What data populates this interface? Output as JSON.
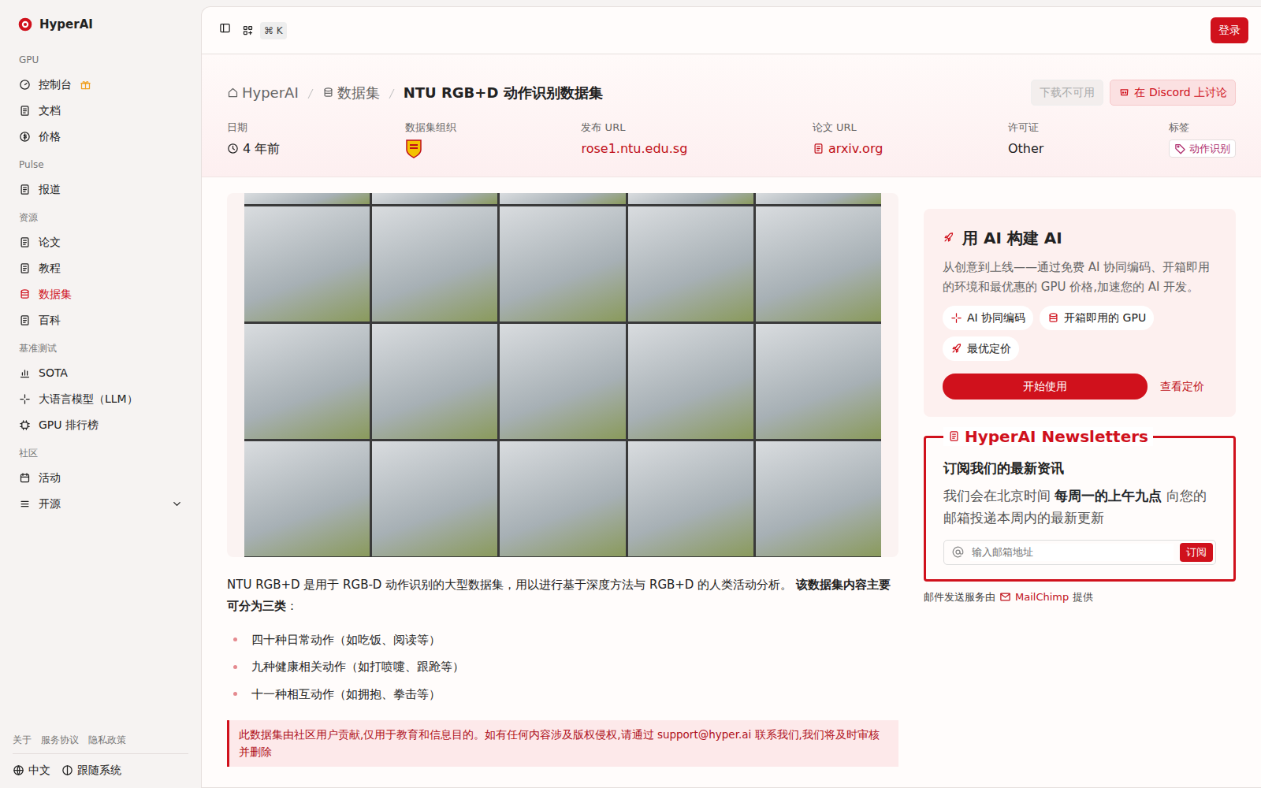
{
  "brand": {
    "name": "HyperAI"
  },
  "sidebar": {
    "groups": [
      {
        "title": "GPU",
        "items": [
          {
            "label": "控制台",
            "selected": false
          },
          {
            "label": "文档",
            "selected": false
          },
          {
            "label": "价格",
            "selected": false
          }
        ]
      },
      {
        "title": "Pulse",
        "items": [
          {
            "label": "报道",
            "selected": false
          }
        ]
      },
      {
        "title": "资源",
        "items": [
          {
            "label": "论文",
            "selected": false
          },
          {
            "label": "教程",
            "selected": false
          },
          {
            "label": "数据集",
            "selected": true
          },
          {
            "label": "百科",
            "selected": false
          }
        ]
      },
      {
        "title": "基准测试",
        "items": [
          {
            "label": "SOTA",
            "selected": false
          },
          {
            "label": "大语言模型（LLM）",
            "selected": false
          },
          {
            "label": "GPU 排行榜",
            "selected": false
          }
        ]
      },
      {
        "title": "社区",
        "items": [
          {
            "label": "活动",
            "selected": false
          },
          {
            "label": "开源",
            "selected": false,
            "expanded": false
          }
        ]
      }
    ],
    "footer_links": [
      "关于",
      "服务协议",
      "隐私政策"
    ],
    "language": "中文",
    "theme": "跟随系统"
  },
  "topbar": {
    "shortcut": "⌘ K",
    "login": "登录"
  },
  "breadcrumb": [
    "HyperAI",
    "数据集",
    "NTU RGB+D 动作识别数据集"
  ],
  "header_buttons": {
    "download": {
      "label": "下载不可用",
      "disabled": true
    },
    "discord": {
      "label": "在 Discord 上讨论"
    }
  },
  "meta": [
    {
      "label": "日期",
      "value": "4 年前",
      "kind": "time"
    },
    {
      "label": "数据集组织",
      "kind": "logo"
    },
    {
      "label": "发布 URL",
      "value": "rose1.ntu.edu.sg",
      "kind": "link"
    },
    {
      "label": "论文 URL",
      "value": "arxiv.org",
      "kind": "doclink"
    },
    {
      "label": "许可证",
      "value": "Other",
      "kind": "text"
    },
    {
      "label": "标签",
      "value": "动作识别",
      "kind": "tag"
    }
  ],
  "description": {
    "text": "NTU RGB+D 是用于 RGB-D 动作识别的大型数据集，用以进行基于深度方法与 RGB+D 的人类活动分析。 ",
    "bold": "该数据集内容主要可分为三类",
    "tail": "："
  },
  "categories": [
    "四十种日常动作（如吃饭、阅读等）",
    "九种健康相关动作（如打喷嚏、跟跄等）",
    "十一种相互动作（如拥抱、拳击等）"
  ],
  "notice": {
    "text": "此数据集由社区用户贡献,仅用于教育和信息目的。如有任何内容涉及版权侵权,请通过 ",
    "email": "support@hyper.ai",
    "tail": " 联系我们,我们将及时审核并删除"
  },
  "promo": {
    "title": "用 AI 构建 AI",
    "text": "从创意到上线——通过免费 AI 协同编码、开箱即用的环境和最优惠的 GPU 价格,加速您的 AI 开发。",
    "features": [
      "AI 协同编码",
      "开箱即用的 GPU",
      "最优定价"
    ],
    "primary": "开始使用",
    "secondary": "查看定价"
  },
  "newsletter": {
    "title": "HyperAI Newsletters",
    "heading": "订阅我们的最新资讯",
    "text": "我们会在北京时间 ",
    "bold": "每周一的上午九点",
    "tail": " 向您的邮箱投递本周内的最新更新",
    "placeholder": "输入邮箱地址",
    "button": "订阅"
  },
  "mail_footer": {
    "text": "邮件发送服务由 ",
    "link": "MailChimp",
    "tail": " 提供"
  }
}
